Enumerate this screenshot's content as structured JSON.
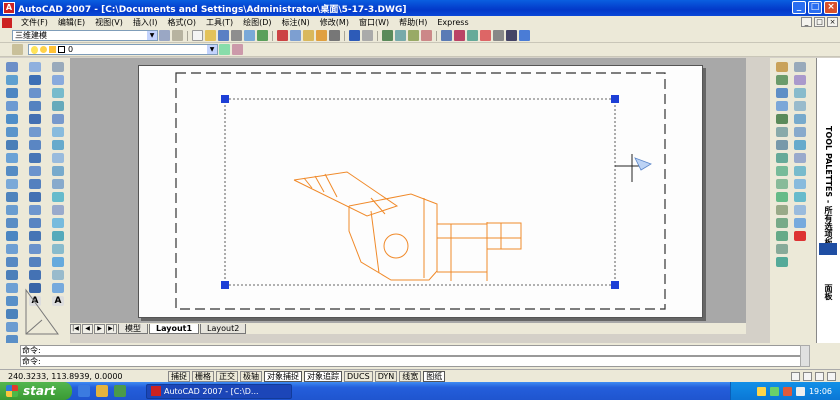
{
  "window": {
    "title": "AutoCAD 2007 - [C:\\Documents and Settings\\Administrator\\桌面\\5-17-3.DWG]",
    "app_icon_letter": "A",
    "minimize": "_",
    "maximize": "□",
    "close": "×"
  },
  "menu": {
    "items": [
      "文件(F)",
      "编辑(E)",
      "视图(V)",
      "插入(I)",
      "格式(O)",
      "工具(T)",
      "绘图(D)",
      "标注(N)",
      "修改(M)",
      "窗口(W)",
      "帮助(H)",
      "Express"
    ]
  },
  "toolbar": {
    "workspace": "三维建模",
    "layer": "0"
  },
  "layout_tabs": {
    "nav": [
      "|◀",
      "◀",
      "▶",
      "▶|"
    ],
    "tabs": [
      "模型",
      "Layout1",
      "Layout2"
    ],
    "active": "Layout1"
  },
  "command": {
    "line1": "命令:",
    "line2": "命令:"
  },
  "status": {
    "coords": "240.3233, 113.8939, 0.0000",
    "toggles": [
      "捕捉",
      "栅格",
      "正交",
      "极轴",
      "对象捕捉",
      "对象追踪",
      "DUCS",
      "DYN",
      "线宽",
      "图纸"
    ],
    "on": [
      "对象捕捉",
      "对象追踪",
      "图纸"
    ]
  },
  "palette": {
    "label": "TOOL PALETTES - 所有选项板",
    "section": "面板"
  },
  "taskbar": {
    "start": "start",
    "task": "AutoCAD 2007 - [C:\\D...",
    "time": "19:06"
  },
  "colors": {
    "drawing": "#f08a2a",
    "grip": "#1d3fd6",
    "titlebar": "#0a5fe0"
  }
}
